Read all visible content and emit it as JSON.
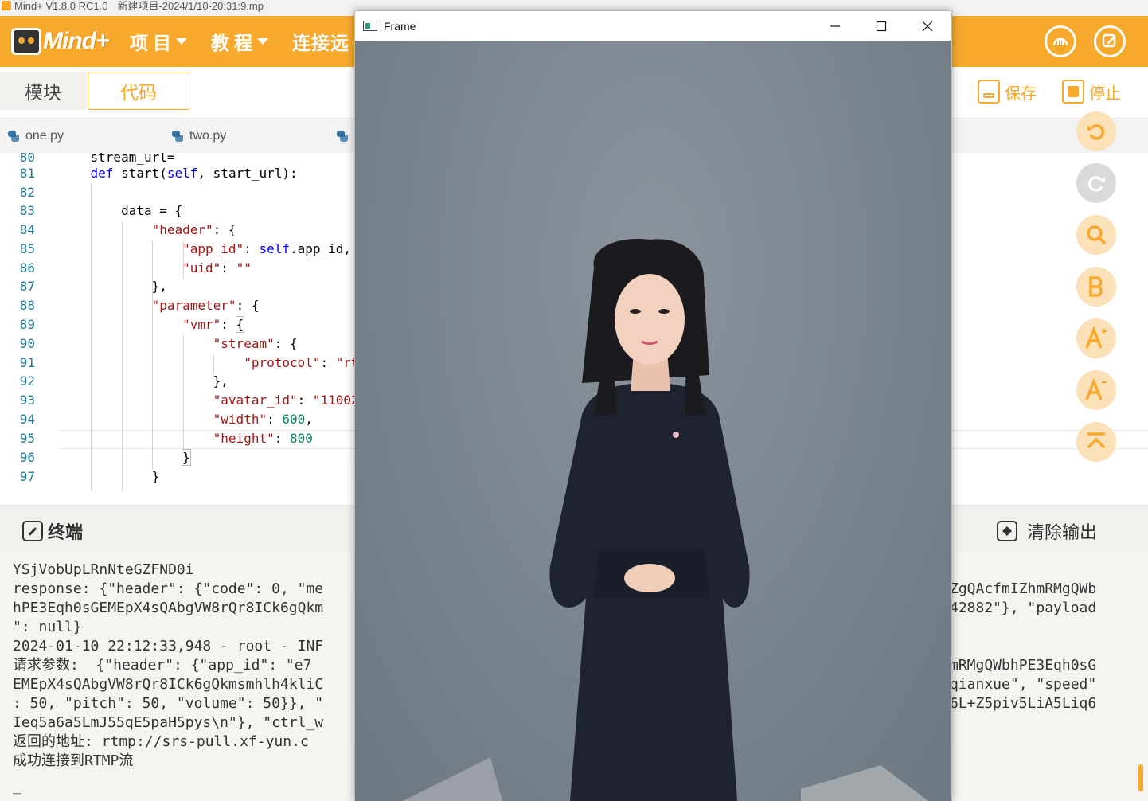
{
  "window": {
    "title": "Mind+ V1.8.0 RC1.0",
    "project": "新建项目-2024/1/10-20:31:9.mp"
  },
  "menubar": {
    "brand": "Mind+",
    "project_menu": "项目",
    "tutorial_menu": "教程",
    "connect_menu": "连接远"
  },
  "toolbar": {
    "tab_blocks": "模块",
    "tab_code": "代码",
    "save_label": "保存",
    "stop_label": "停止"
  },
  "file_tabs": [
    "one.py",
    "two.py",
    ""
  ],
  "editor": {
    "lines": [
      {
        "num": "80",
        "code": "    stream_url="
      },
      {
        "num": "81",
        "code": "    def start(self, start_url):"
      },
      {
        "num": "82",
        "code": ""
      },
      {
        "num": "83",
        "code": "        data = {"
      },
      {
        "num": "84",
        "code": "            \"header\": {"
      },
      {
        "num": "85",
        "code": "                \"app_id\": self.app_id,"
      },
      {
        "num": "86",
        "code": "                \"uid\": \"\""
      },
      {
        "num": "87",
        "code": "            },"
      },
      {
        "num": "88",
        "code": "            \"parameter\": {"
      },
      {
        "num": "89",
        "code": "                \"vmr\": {"
      },
      {
        "num": "90",
        "code": "                    \"stream\": {"
      },
      {
        "num": "91",
        "code": "                        \"protocol\": \"rt"
      },
      {
        "num": "92",
        "code": "                    },"
      },
      {
        "num": "93",
        "code": "                    \"avatar_id\": \"11002"
      },
      {
        "num": "94",
        "code": "                    \"width\": 600,"
      },
      {
        "num": "95",
        "code": "                    \"height\": 800"
      },
      {
        "num": "96",
        "code": "                }"
      },
      {
        "num": "97",
        "code": "            }"
      }
    ]
  },
  "side_toolbar": [
    "undo-icon",
    "redo-icon",
    "search-icon",
    "bold-icon",
    "font-increase-icon",
    "font-decrease-icon",
    "collapse-icon"
  ],
  "terminal": {
    "title": "终端",
    "clear_label": "清除输出",
    "lines": [
      {
        "left": "YSjVobUpLRnNteGZFND0i",
        "right": ""
      },
      {
        "left": "response: {\"header\": {\"code\": 0, \"me",
        "right": "ZgQAcfmIZhmRMgQWb"
      },
      {
        "left": "hPE3Eqh0sGEMEpX4sQAbgVW8rQr8ICk6gQkm",
        "right": "42882\"}, \"payload"
      },
      {
        "left": "\": null}",
        "right": ""
      },
      {
        "left": "2024-01-10 22:12:33,948 - root - INF",
        "right": ""
      },
      {
        "left": "请求参数:  {\"header\": {\"app_id\": \"e7",
        "right": "mRMgQWbhPE3Eqh0sG"
      },
      {
        "left": "EMEpX4sQAbgVW8rQr8ICk6gQkmsmhlh4kliC",
        "right": "qianxue\", \"speed\""
      },
      {
        "left": ": 50, \"pitch\": 50, \"volume\": 50}}, \"",
        "right": "6L+Z5piv5LiA5Liq6"
      },
      {
        "left": "Ieq5a6a5LmJ55qE5paH5pys\\n\"}, \"ctrl_w",
        "right": ""
      },
      {
        "left": "返回的地址: rtmp://srs-pull.xf-yun.c",
        "right": ""
      },
      {
        "left": "成功连接到RTMP流",
        "right": ""
      },
      {
        "left": "",
        "right": ""
      },
      {
        "left": "_",
        "right": ""
      }
    ]
  },
  "frame_window": {
    "title": "Frame"
  },
  "colors": {
    "accent": "#f7a92e",
    "string": "#a31515",
    "keyword": "#0000ff",
    "number": "#098658",
    "line_number": "#237893"
  }
}
